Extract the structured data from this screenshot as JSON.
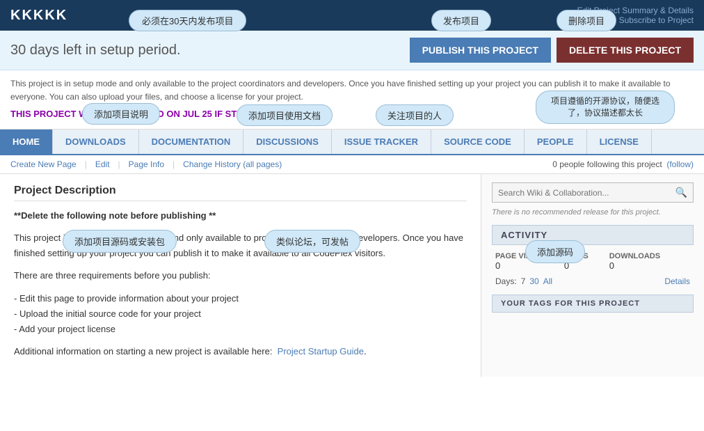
{
  "header": {
    "logo": "KKKKK",
    "edit_link": "Edit Project Summary & Details",
    "subscribe_link": "Subscribe to Project"
  },
  "tooltips": {
    "publish_requirement": "必须在30天内发布项目",
    "publish_project": "发布项目",
    "delete_project": "删除项目",
    "add_description": "添加项目说明",
    "add_docs": "添加项目使用文档",
    "add_followers": "关注项目的人",
    "open_source_note": "项目遵循的开源协议，随便选了，协议描述都太长",
    "add_source": "添加项目源码或安装包",
    "add_forum": "类似论坛，可发帖",
    "add_source_code": "添加源码"
  },
  "banner": {
    "text": "30 days left in setup period.",
    "publish_btn": "PUBLISH THIS PROJECT",
    "delete_btn": "DELETE THIS PROJECT"
  },
  "notice": {
    "text1": "This project is in setup mode and only available to the project coordinators and developers. Once you have finished setting up your project you can publish it to make it available to everyone. You can also upload your files, and choose a license for your project.",
    "warning": "THIS PROJECT WILL BE REMOVED ON JUL 25 IF STILL UNPUBLISHED."
  },
  "nav": {
    "tabs": [
      {
        "label": "HOME",
        "active": true
      },
      {
        "label": "DOWNLOADS",
        "active": false
      },
      {
        "label": "DOCUMENTATION",
        "active": false
      },
      {
        "label": "DISCUSSIONS",
        "active": false
      },
      {
        "label": "ISSUE TRACKER",
        "active": false
      },
      {
        "label": "SOURCE CODE",
        "active": false
      },
      {
        "label": "PEOPLE",
        "active": false
      },
      {
        "label": "LICENSE",
        "active": false
      }
    ]
  },
  "subnav": {
    "links": [
      {
        "label": "Create New Page"
      },
      {
        "label": "Edit"
      },
      {
        "label": "Page Info"
      },
      {
        "label": "Change History (all pages)"
      }
    ],
    "followers_text": "0 people following this project",
    "follow_link": "(follow)"
  },
  "main": {
    "section_title": "Project Description",
    "content_bold": "**Delete the following note before publishing **",
    "content_para1": "This project is currently in setup mode and only available to project coordinators and developers. Once you have finished setting up your project you can publish it to make it available to all CodePlex visitors.",
    "content_para2": "There are three requirements before you publish:",
    "content_list": [
      "Edit this page to provide information about your project",
      "Upload the initial source code for your project",
      "Add your project license"
    ],
    "content_footer": "Additional information on starting a new project is available here:",
    "guide_link": "Project Startup Guide"
  },
  "sidebar": {
    "search_placeholder": "Search Wiki & Collaboration...",
    "search_btn_icon": "🔍",
    "release_note": "There is no recommended release for this project.",
    "activity": {
      "header": "ACTIVITY",
      "stats": [
        {
          "label": "PAGE VIEWS",
          "value": "0"
        },
        {
          "label": "VISITS",
          "value": "0"
        },
        {
          "label": "DOWNLOADS",
          "value": "0"
        }
      ],
      "days_label": "Days:",
      "days": [
        {
          "label": "7",
          "active": false
        },
        {
          "label": "30",
          "active": true
        },
        {
          "label": "All",
          "active": false
        }
      ],
      "details_link": "Details"
    },
    "tags": {
      "header": "YOUR TAGS FOR THIS PROJECT"
    }
  }
}
